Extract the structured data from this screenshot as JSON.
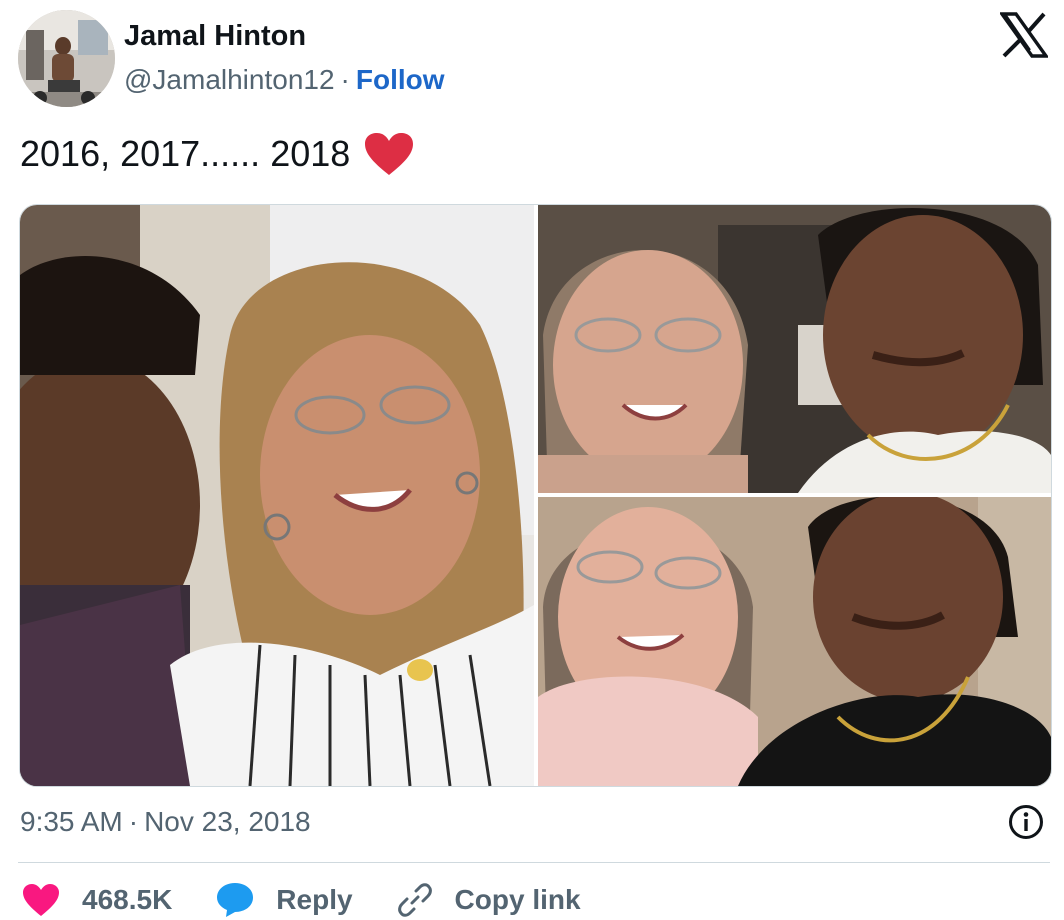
{
  "author": {
    "name": "Jamal Hinton",
    "handle": "@Jamalhinton12",
    "separator": "·",
    "follow_label": "Follow"
  },
  "platform_icon": "x-logo-icon",
  "tweet": {
    "text": "2016, 2017...... 2018",
    "emoji": "red-heart-emoji"
  },
  "media": {
    "count": 3,
    "photos": [
      "selfie-photo-2016",
      "selfie-photo-2017",
      "selfie-photo-2018"
    ]
  },
  "meta": {
    "time": "9:35 AM",
    "separator": "·",
    "date": "Nov 23, 2018",
    "info_icon": "info-icon"
  },
  "actions": {
    "likes": "468.5K",
    "reply_label": "Reply",
    "copy_link_label": "Copy link"
  },
  "colors": {
    "follow": "#1d67c8",
    "like": "#f91880",
    "reply_bubble": "#1d9bf0",
    "muted": "#536471",
    "emoji_heart": "#dd2e44"
  }
}
